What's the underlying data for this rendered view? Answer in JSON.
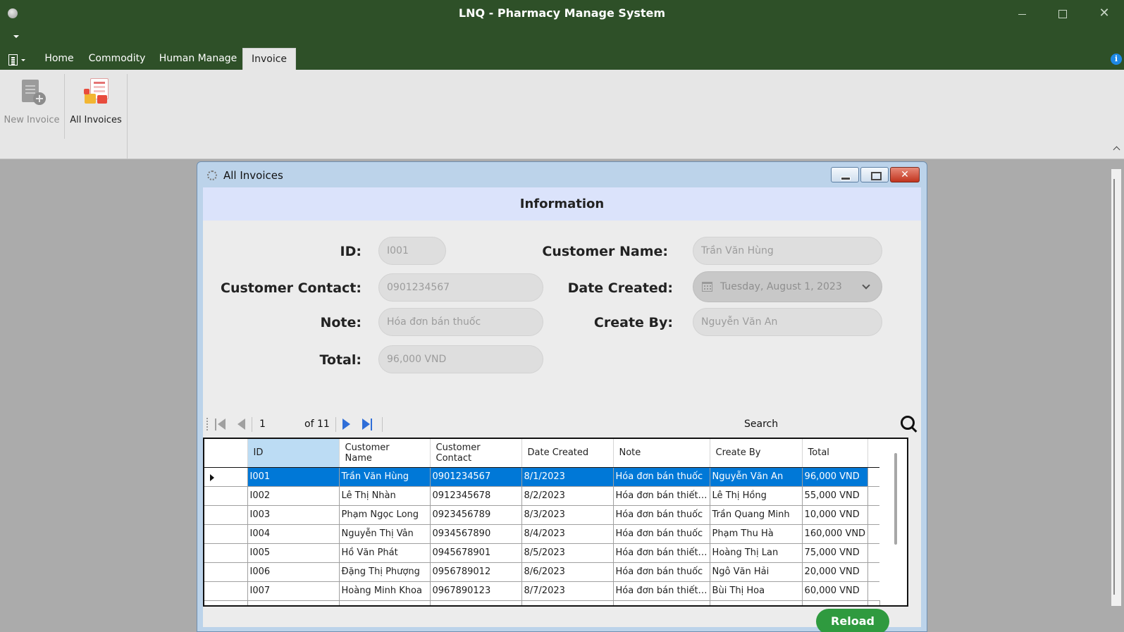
{
  "window": {
    "title": "LNQ - Pharmacy Manage System",
    "close_glyph": "✕"
  },
  "ribbon": {
    "tabs": [
      {
        "label": "Home"
      },
      {
        "label": "Commodity"
      },
      {
        "label": "Human Manage"
      },
      {
        "label": "Invoice"
      }
    ],
    "active_tab": "Invoice",
    "buttons": {
      "new_invoice": "New Invoice",
      "all_invoices": "All Invoices"
    },
    "info_glyph": "i"
  },
  "child_window": {
    "title": "All Invoices",
    "close_glyph": "✕"
  },
  "form": {
    "header": "Information",
    "labels": {
      "id": "ID:",
      "customer_name": "Customer Name:",
      "customer_contact": "Customer Contact:",
      "date_created": "Date Created:",
      "note": "Note:",
      "create_by": "Create By:",
      "total": "Total:"
    },
    "values": {
      "id": "I001",
      "customer_name": "Trần Văn Hùng",
      "customer_contact": "0901234567",
      "date_created": "Tuesday, August 1, 2023",
      "note": "Hóa đơn bán thuốc",
      "create_by": "Nguyễn Văn An",
      "total": "96,000 VND"
    }
  },
  "navigator": {
    "position": "1",
    "of_label": "of 11",
    "search_label": "Search",
    "search_value": ""
  },
  "grid": {
    "columns": [
      "ID",
      "Customer\nName",
      "Customer\nContact",
      "Date Created",
      "Note",
      "Create By",
      "Total"
    ],
    "rows": [
      [
        "I001",
        "Trần Văn Hùng",
        "0901234567",
        "8/1/2023",
        "Hóa đơn bán thuốc",
        "Nguyễn Văn An",
        "96,000 VND"
      ],
      [
        "I002",
        "Lê Thị Nhàn",
        "0912345678",
        "8/2/2023",
        "Hóa đơn bán thiết…",
        "Lê Thị Hồng",
        "55,000 VND"
      ],
      [
        "I003",
        "Phạm Ngọc Long",
        "0923456789",
        "8/3/2023",
        "Hóa đơn bán thuốc",
        "Trần Quang Minh",
        "10,000 VND"
      ],
      [
        "I004",
        "Nguyễn Thị Vân",
        "0934567890",
        "8/4/2023",
        "Hóa đơn bán thuốc",
        "Phạm Thu Hà",
        "160,000 VND"
      ],
      [
        "I005",
        "Hồ Văn Phát",
        "0945678901",
        "8/5/2023",
        "Hóa đơn bán thiết…",
        "Hoàng Thị Lan",
        "75,000 VND"
      ],
      [
        "I006",
        "Đặng Thị Phượng",
        "0956789012",
        "8/6/2023",
        "Hóa đơn bán thuốc",
        "Ngô Văn Hải",
        "20,000 VND"
      ],
      [
        "I007",
        "Hoàng Minh Khoa",
        "0967890123",
        "8/7/2023",
        "Hóa đơn bán thiết…",
        "Bùi Thị Hoa",
        "60,000 VND"
      ]
    ],
    "selected_row": 0
  },
  "actions": {
    "reload": "Reload"
  },
  "colors": {
    "titlebar": "#2e5028",
    "selection": "#0078d7",
    "reload_button": "#2f9a3f",
    "info_header": "#dbe3fb"
  }
}
